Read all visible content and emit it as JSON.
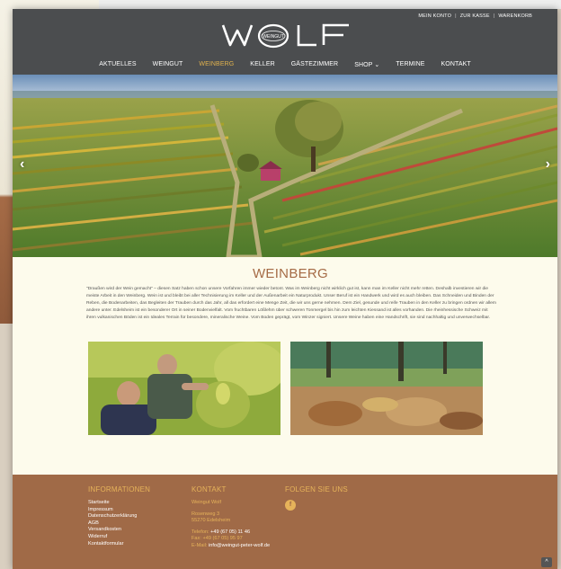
{
  "topnav": {
    "items": [
      "MEIN KONTO",
      "ZUR KASSE",
      "WARENKORB"
    ],
    "separator": "|"
  },
  "logo": {
    "left": "W",
    "badge": "WEINGUT",
    "right": "LF"
  },
  "mainnav": {
    "items": [
      {
        "label": "AKTUELLES"
      },
      {
        "label": "WEINGUT"
      },
      {
        "label": "WEINBERG"
      },
      {
        "label": "KELLER"
      },
      {
        "label": "GÄSTEZIMMER"
      },
      {
        "label": "SHOP ⌄"
      },
      {
        "label": "TERMINE"
      },
      {
        "label": "KONTAKT"
      }
    ],
    "active_index": 2
  },
  "hero": {
    "prev_icon": "chevron-left-icon",
    "next_icon": "chevron-right-icon",
    "prev_glyph": "‹",
    "next_glyph": "›"
  },
  "section": {
    "title": "WEINBERG",
    "text": "\"Draußen wird der Wein gemacht\" – diesen Satz haben schon unsere Vorfahren immer wieder betont. Was im Weinberg nicht wirklich gut ist, kann man im Keller nicht mehr retten. Deshalb investieren wir die meiste Arbeit in den Weinberg. Wein ist und bleibt bei aller Technisierung im Keller und der Außenarbeit ein Naturprodukt. Unser Beruf ist ein Handwerk und wird es auch bleiben. Das Schneiden und Binden der Reben, die Bodenarbeiten, das Begleiten der Trauben durch das Jahr, all das erfordert eine Menge Zeit, die wir uns gerne nehmen. Dem Ziel, gesunde und reife Trauben in den Keller zu bringen ordnen wir allem andere unter. Edelsheim ist ein besonderer Ort in seiner Bodenvielfalt. Vom fruchtbaren Lößlehm über schweren Tonmergel bis hin zum leichten Kiessand ist alles vorhanden. Die rheinhessische Schweiz mit ihren vulkanischen Böden ist ein Ideales Terrain für besondere, mineralische Weine. Vom Boden geprägt, vom Winzer signiert. Unsere Weine haben eine Handschrift, sie sind nachhaltig und unverwechselbar."
  },
  "footer": {
    "info": {
      "heading": "INFORMATIONEN",
      "links": [
        "Startseite",
        "Impressum",
        "Datenschutzerklärung",
        "AGB",
        "Versandkosten",
        "Widerruf",
        "Kontaktformular"
      ]
    },
    "kontakt": {
      "heading": "KONTAKT",
      "name": "Weingut Wolf",
      "street": "Rosenweg 3",
      "city": "55270 Edelsheim",
      "phone_label": "Telefon:",
      "phone": "+49 (67 05) 11 46",
      "fax_label": "Fax:",
      "fax": "+49 (67 05) 95 97",
      "mail_label": "E-Mail:",
      "mail": "info@weingut-peter-wolf.de"
    },
    "social": {
      "heading": "FOLGEN SIE UNS",
      "fb_glyph": "f"
    },
    "scrolltop_glyph": "^"
  },
  "colors": {
    "header_bg": "#4b4d4f",
    "accent": "#e0b24e",
    "title_brown": "#a56b46",
    "footer_bg": "#a06a47",
    "page_bg": "#fdfbec"
  }
}
